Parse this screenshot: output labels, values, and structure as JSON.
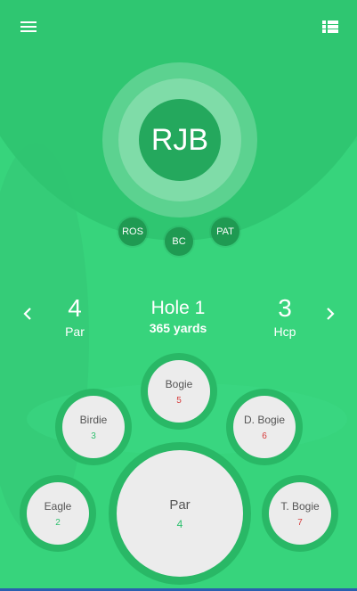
{
  "header": {
    "menu_icon": "hamburger-menu-icon",
    "list_icon": "list-view-icon"
  },
  "current_player": {
    "initials": "RJB"
  },
  "players": [
    {
      "initials": "ROS"
    },
    {
      "initials": "BC"
    },
    {
      "initials": "PAT"
    }
  ],
  "hole": {
    "par_value": "4",
    "par_label": "Par",
    "title": "Hole 1",
    "yards": "365 yards",
    "hcp_value": "3",
    "hcp_label": "Hcp",
    "prev_icon": "chevron-left-icon",
    "next_icon": "chevron-right-icon"
  },
  "scores": {
    "bogie": {
      "label": "Bogie",
      "value": "5"
    },
    "birdie": {
      "label": "Birdie",
      "value": "3"
    },
    "dbogie": {
      "label": "D. Bogie",
      "value": "6"
    },
    "eagle": {
      "label": "Eagle",
      "value": "2"
    },
    "par": {
      "label": "Par",
      "value": "4"
    },
    "tbogie": {
      "label": "T. Bogie",
      "value": "7"
    }
  },
  "colors": {
    "background": "#37d47c",
    "hero": "#2fc470",
    "avatar": "#24a85d",
    "under_par": "#2fc06f",
    "over_par": "#d63b3b"
  }
}
